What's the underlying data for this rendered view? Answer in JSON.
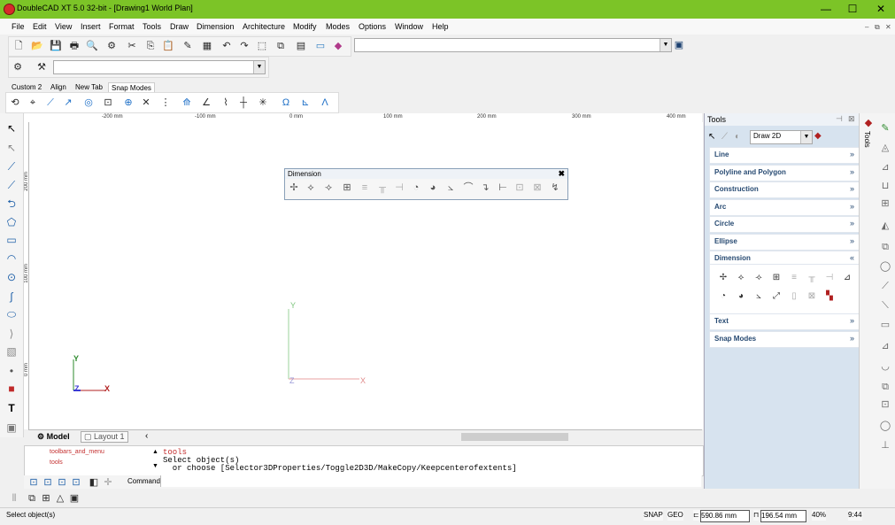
{
  "window": {
    "title": "DoubleCAD XT 5.0 32-bit - [Drawing1 World Plan]",
    "minimize": "—",
    "maximize": "☐",
    "close": "✕"
  },
  "menu": {
    "items": [
      {
        "label": "File"
      },
      {
        "label": "Edit"
      },
      {
        "label": "View"
      },
      {
        "label": "Insert"
      },
      {
        "label": "Format"
      },
      {
        "label": "Tools"
      },
      {
        "label": "Draw"
      },
      {
        "label": "Dimension"
      },
      {
        "label": "Architecture"
      },
      {
        "label": "Modify"
      },
      {
        "label": "Modes"
      },
      {
        "label": "Options"
      },
      {
        "label": "Window"
      },
      {
        "label": "Help"
      }
    ],
    "mdi_minimize": "–",
    "mdi_restore": "⧉",
    "mdi_close": "✕"
  },
  "toolbar_tabs": [
    "Custom 2",
    "Align",
    "New Tab",
    "Snap Modes"
  ],
  "rulers": {
    "h_labels": [
      "-200 mm",
      "-100 mm",
      "0 mm",
      "100 mm",
      "200 mm",
      "300 mm",
      "400 mm"
    ],
    "v_labels": [
      "200 mm",
      "100 mm",
      "0 mm"
    ]
  },
  "dimension_toolbar": {
    "title": "Dimension",
    "close": "✖"
  },
  "canvas": {
    "axis_y": "Y",
    "axis_z": "Z",
    "axis_x": "X"
  },
  "bottom_tabs": {
    "model": "Model",
    "layout": "Layout 1",
    "scroll_left": "‹"
  },
  "tree": {
    "item1": "toolbars_and_menu",
    "item2": "tools"
  },
  "command": {
    "line1": "tools",
    "line2": "Select object(s)",
    "line3": "  or choose [Selector3DProperties/Toggle2D3D/MakeCopy/Keepcenterofextents]",
    "label": "Command:",
    "value": ""
  },
  "status": {
    "message": "Select object(s)",
    "snap": "SNAP",
    "geo": "GEO",
    "x": "590.86 mm",
    "y": "196.54 mm",
    "zoom": "40%",
    "time": "9:44"
  },
  "tools_panel": {
    "title": "Tools",
    "mode_value": "Draw 2D",
    "vertical_tab": "Tools",
    "sections": [
      "Line",
      "Polyline and Polygon",
      "Construction",
      "Arc",
      "Circle",
      "Ellipse",
      "Dimension",
      "Text",
      "Snap Modes"
    ]
  }
}
